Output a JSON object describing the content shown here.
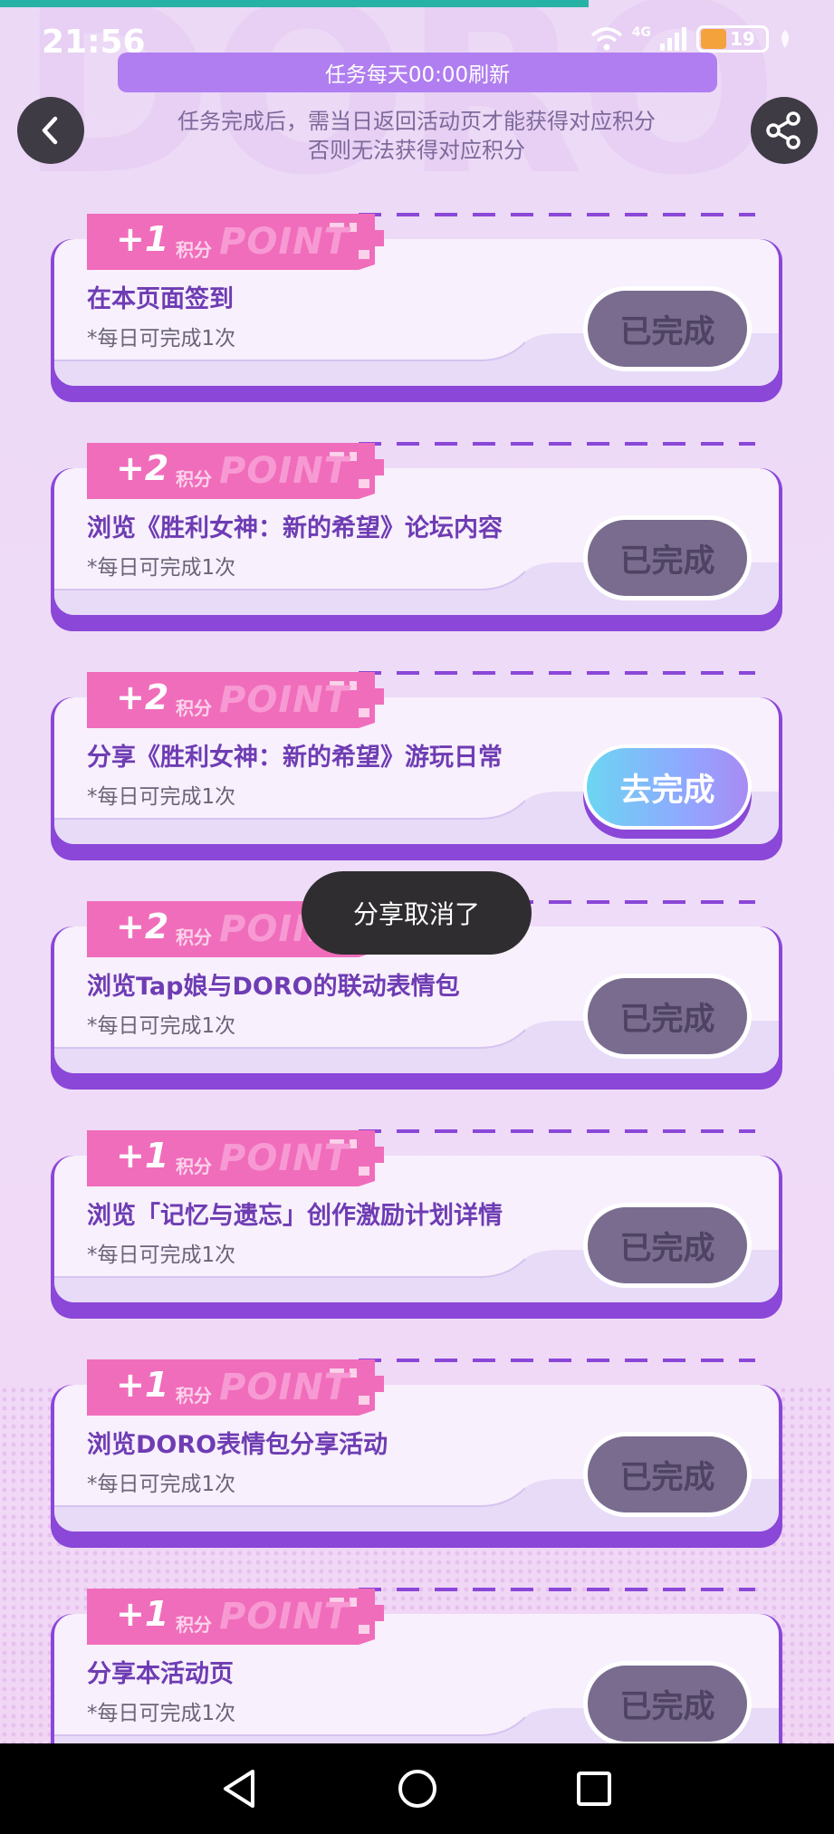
{
  "status_bar": {
    "time": "21:56",
    "network": "4G",
    "battery_level": "19"
  },
  "header": {
    "banner": "任务每天00:00刷新",
    "subtitle_line1": "任务完成后，需当日返回活动页才能获得对应积分",
    "subtitle_line2": "否则无法获得对应积分"
  },
  "tasks": [
    {
      "points": "+1",
      "unit": "积分",
      "tag_word": "POINT",
      "title": "在本页面签到",
      "note": "*每日可完成1次",
      "button": "已完成",
      "done": true
    },
    {
      "points": "+2",
      "unit": "积分",
      "tag_word": "POINT",
      "title": "浏览《胜利女神：新的希望》论坛内容",
      "note": "*每日可完成1次",
      "button": "已完成",
      "done": true
    },
    {
      "points": "+2",
      "unit": "积分",
      "tag_word": "POINT",
      "title": "分享《胜利女神：新的希望》游玩日常",
      "note": "*每日可完成1次",
      "button": "去完成",
      "done": false
    },
    {
      "points": "+2",
      "unit": "积分",
      "tag_word": "POINT",
      "title": "浏览Tap娘与DORO的联动表情包",
      "note": "*每日可完成1次",
      "button": "已完成",
      "done": true
    },
    {
      "points": "+1",
      "unit": "积分",
      "tag_word": "POINT",
      "title": "浏览「记忆与遗忘」创作激励计划详情",
      "note": "*每日可完成1次",
      "button": "已完成",
      "done": true
    },
    {
      "points": "+1",
      "unit": "积分",
      "tag_word": "POINT",
      "title": "浏览DORO表情包分享活动",
      "note": "*每日可完成1次",
      "button": "已完成",
      "done": true
    },
    {
      "points": "+1",
      "unit": "积分",
      "tag_word": "POINT",
      "title": "分享本活动页",
      "note": "*每日可完成1次",
      "button": "已完成",
      "done": true
    }
  ],
  "toast": "分享取消了",
  "icons": {
    "back": "back-arrow-icon",
    "share": "share-icon"
  },
  "colors": {
    "accent": "#8a47d8",
    "tag": "#f06dbb",
    "done_button": "#7a6c8f",
    "banner": "#b07ef0"
  }
}
